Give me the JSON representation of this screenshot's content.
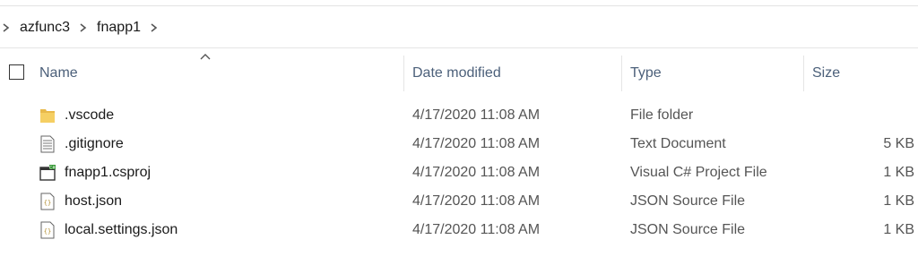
{
  "breadcrumb": {
    "items": [
      "azfunc3",
      "fnapp1"
    ]
  },
  "columns": {
    "name": "Name",
    "date": "Date modified",
    "type": "Type",
    "size": "Size"
  },
  "files": [
    {
      "name": ".vscode",
      "date": "4/17/2020 11:08 AM",
      "type": "File folder",
      "size": "",
      "icon": "folder-icon"
    },
    {
      "name": ".gitignore",
      "date": "4/17/2020 11:08 AM",
      "type": "Text Document",
      "size": "5 KB",
      "icon": "text-file-icon"
    },
    {
      "name": "fnapp1.csproj",
      "date": "4/17/2020 11:08 AM",
      "type": "Visual C# Project File",
      "size": "1 KB",
      "icon": "csharp-project-icon"
    },
    {
      "name": "host.json",
      "date": "4/17/2020 11:08 AM",
      "type": "JSON Source File",
      "size": "1 KB",
      "icon": "json-file-icon"
    },
    {
      "name": "local.settings.json",
      "date": "4/17/2020 11:08 AM",
      "type": "JSON Source File",
      "size": "1 KB",
      "icon": "json-file-icon"
    }
  ],
  "colors": {
    "header_text": "#4c607a",
    "folder": "#e8b94a",
    "separator": "#e5e5e5"
  }
}
